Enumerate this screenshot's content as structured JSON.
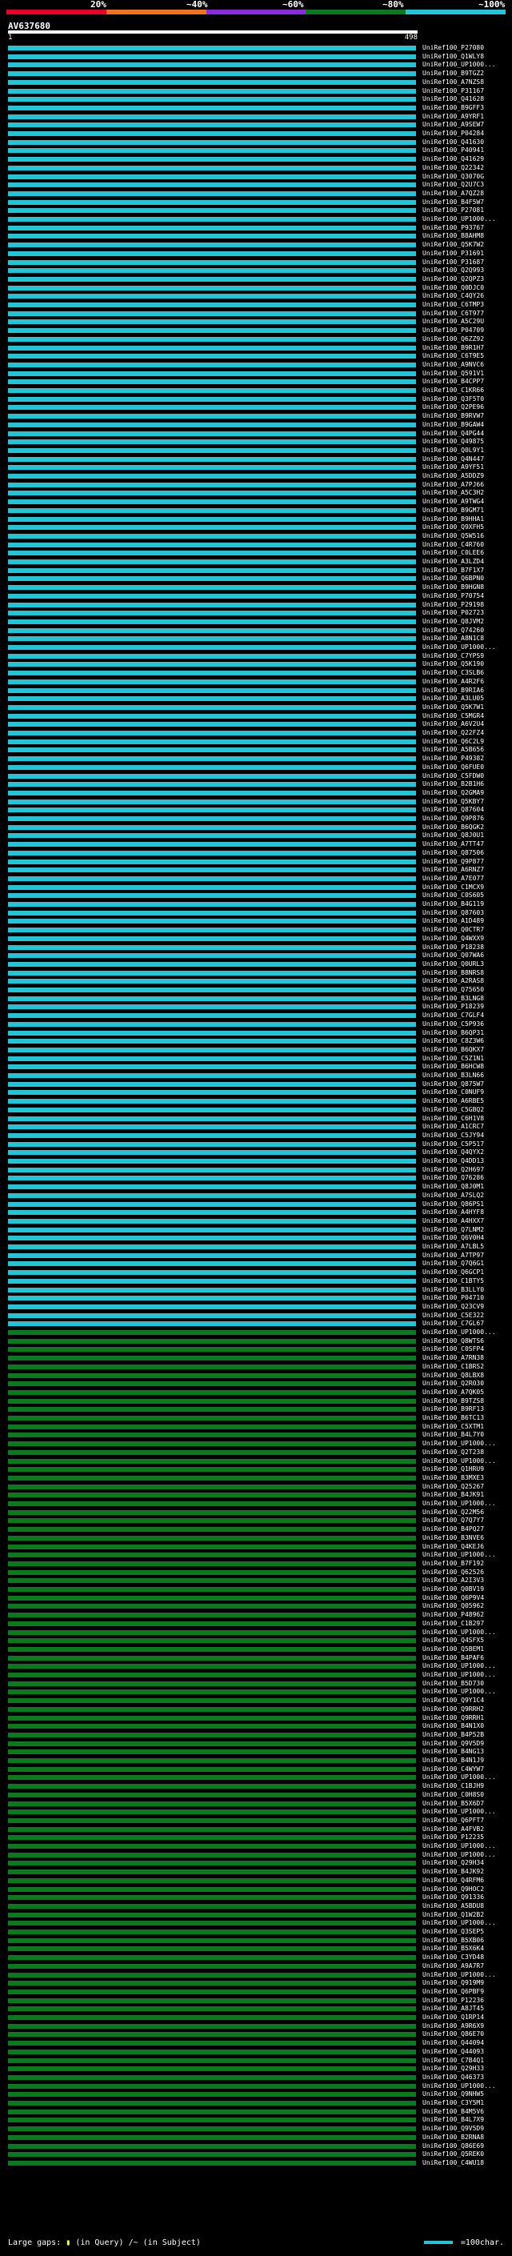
{
  "legend": {
    "labels": [
      "20%",
      "~40%",
      "~60%",
      "~80%",
      "~100%"
    ],
    "colors": [
      "#e8002a",
      "#f2711c",
      "#8a2be2",
      "#0b7a1e",
      "#22c5d6"
    ]
  },
  "query": {
    "title": "AV637680",
    "start_label": "1",
    "end_label": "498"
  },
  "hits": [
    {
      "label": "UniRef100_P27080",
      "color": "#22c5d6"
    },
    {
      "label": "UniRef100_Q1WLY8",
      "color": "#22c5d6"
    },
    {
      "label": "UniRef100_UP1000...",
      "color": "#22c5d6"
    },
    {
      "label": "UniRef100_B9TGZ2",
      "color": "#22c5d6"
    },
    {
      "label": "UniRef100_A7NZS8",
      "color": "#22c5d6"
    },
    {
      "label": "UniRef100_P31167",
      "color": "#22c5d6"
    },
    {
      "label": "UniRef100_Q41628",
      "color": "#22c5d6"
    },
    {
      "label": "UniRef100_B9GFF3",
      "color": "#22c5d6"
    },
    {
      "label": "UniRef100_A9YRF1",
      "color": "#22c5d6"
    },
    {
      "label": "UniRef100_A9SEW7",
      "color": "#22c5d6"
    },
    {
      "label": "UniRef100_P04284",
      "color": "#22c5d6"
    },
    {
      "label": "UniRef100_Q41630",
      "color": "#22c5d6"
    },
    {
      "label": "UniRef100_P40941",
      "color": "#22c5d6"
    },
    {
      "label": "UniRef100_Q41629",
      "color": "#22c5d6"
    },
    {
      "label": "UniRef100_Q22342",
      "color": "#22c5d6"
    },
    {
      "label": "UniRef100_Q3070G",
      "color": "#22c5d6"
    },
    {
      "label": "UniRef100_Q2U7C3",
      "color": "#22c5d6"
    },
    {
      "label": "UniRef100_A7QZ28",
      "color": "#22c5d6"
    },
    {
      "label": "UniRef100_B4F5W7",
      "color": "#22c5d6"
    },
    {
      "label": "UniRef100_P27081",
      "color": "#22c5d6"
    },
    {
      "label": "UniRef100_UP1000...",
      "color": "#22c5d6"
    },
    {
      "label": "UniRef100_P93767",
      "color": "#22c5d6"
    },
    {
      "label": "UniRef100_B8AHM8",
      "color": "#22c5d6"
    },
    {
      "label": "UniRef100_Q5K7W2",
      "color": "#22c5d6"
    },
    {
      "label": "UniRef100_P31691",
      "color": "#22c5d6"
    },
    {
      "label": "UniRef100_P31687",
      "color": "#22c5d6"
    },
    {
      "label": "UniRef100_Q2Q993",
      "color": "#22c5d6"
    },
    {
      "label": "UniRef100_Q2QPZ3",
      "color": "#22c5d6"
    },
    {
      "label": "UniRef100_Q0DJC0",
      "color": "#22c5d6"
    },
    {
      "label": "UniRef100_C4QY26",
      "color": "#22c5d6"
    },
    {
      "label": "UniRef100_C6TMP3",
      "color": "#22c5d6"
    },
    {
      "label": "UniRef100_C6T977",
      "color": "#22c5d6"
    },
    {
      "label": "UniRef100_A5C29U",
      "color": "#22c5d6"
    },
    {
      "label": "UniRef100_P04709",
      "color": "#22c5d6"
    },
    {
      "label": "UniRef100_Q6ZZ92",
      "color": "#22c5d6"
    },
    {
      "label": "UniRef100_B9R1H7",
      "color": "#22c5d6"
    },
    {
      "label": "UniRef100_C6T9E5",
      "color": "#22c5d6"
    },
    {
      "label": "UniRef100_A9NVC6",
      "color": "#22c5d6"
    },
    {
      "label": "UniRef100_Q591V1",
      "color": "#22c5d6"
    },
    {
      "label": "UniRef100_B4CPP7",
      "color": "#22c5d6"
    },
    {
      "label": "UniRef100_C1KR66",
      "color": "#22c5d6"
    },
    {
      "label": "UniRef100_Q3F5T0",
      "color": "#22c5d6"
    },
    {
      "label": "UniRef100_Q2PE96",
      "color": "#22c5d6"
    },
    {
      "label": "UniRef100_B9RVW7",
      "color": "#22c5d6"
    },
    {
      "label": "UniRef100_B9GAW4",
      "color": "#22c5d6"
    },
    {
      "label": "UniRef100_Q4PG44",
      "color": "#22c5d6"
    },
    {
      "label": "UniRef100_Q49875",
      "color": "#22c5d6"
    },
    {
      "label": "UniRef100_Q0L9Y1",
      "color": "#22c5d6"
    },
    {
      "label": "UniRef100_Q4N447",
      "color": "#22c5d6"
    },
    {
      "label": "UniRef100_A9YF51",
      "color": "#22c5d6"
    },
    {
      "label": "UniRef100_A5DDZ9",
      "color": "#22c5d6"
    },
    {
      "label": "UniRef100_A7PJ66",
      "color": "#22c5d6"
    },
    {
      "label": "UniRef100_A5C3H2",
      "color": "#22c5d6"
    },
    {
      "label": "UniRef100_A9TWG4",
      "color": "#22c5d6"
    },
    {
      "label": "UniRef100_B9GM71",
      "color": "#22c5d6"
    },
    {
      "label": "UniRef100_B9HHA1",
      "color": "#22c5d6"
    },
    {
      "label": "UniRef100_Q9XFH5",
      "color": "#22c5d6"
    },
    {
      "label": "UniRef100_Q5W516",
      "color": "#22c5d6"
    },
    {
      "label": "UniRef100_C4R760",
      "color": "#22c5d6"
    },
    {
      "label": "UniRef100_C0LEE6",
      "color": "#22c5d6"
    },
    {
      "label": "UniRef100_A3LZD4",
      "color": "#22c5d6"
    },
    {
      "label": "UniRef100_B7F1X7",
      "color": "#22c5d6"
    },
    {
      "label": "UniRef100_Q6BPN0",
      "color": "#22c5d6"
    },
    {
      "label": "UniRef100_B9HGN8",
      "color": "#22c5d6"
    },
    {
      "label": "UniRef100_P70754",
      "color": "#22c5d6"
    },
    {
      "label": "UniRef100_P29198",
      "color": "#22c5d6"
    },
    {
      "label": "UniRef100_P02723",
      "color": "#22c5d6"
    },
    {
      "label": "UniRef100_Q8JVM2",
      "color": "#22c5d6"
    },
    {
      "label": "UniRef100_Q74260",
      "color": "#22c5d6"
    },
    {
      "label": "UniRef100_A8N1C8",
      "color": "#22c5d6"
    },
    {
      "label": "UniRef100_UP1000...",
      "color": "#22c5d6"
    },
    {
      "label": "UniRef100_C7YPS9",
      "color": "#22c5d6"
    },
    {
      "label": "UniRef100_Q5K190",
      "color": "#22c5d6"
    },
    {
      "label": "UniRef100_C3SLB6",
      "color": "#22c5d6"
    },
    {
      "label": "UniRef100_A4R2F6",
      "color": "#22c5d6"
    },
    {
      "label": "UniRef100_B9RIA6",
      "color": "#22c5d6"
    },
    {
      "label": "UniRef100_A3LU05",
      "color": "#22c5d6"
    },
    {
      "label": "UniRef100_Q5K7W1",
      "color": "#22c5d6"
    },
    {
      "label": "UniRef100_C5MGR4",
      "color": "#22c5d6"
    },
    {
      "label": "UniRef100_A6V2U4",
      "color": "#22c5d6"
    },
    {
      "label": "UniRef100_Q22FZ4",
      "color": "#22c5d6"
    },
    {
      "label": "UniRef100_Q6C2L9",
      "color": "#22c5d6"
    },
    {
      "label": "UniRef100_A5B656",
      "color": "#22c5d6"
    },
    {
      "label": "UniRef100_P49382",
      "color": "#22c5d6"
    },
    {
      "label": "UniRef100_Q6FUE0",
      "color": "#22c5d6"
    },
    {
      "label": "UniRef100_C5FDW0",
      "color": "#22c5d6"
    },
    {
      "label": "UniRef100_B2B1H6",
      "color": "#22c5d6"
    },
    {
      "label": "UniRef100_Q2GMA9",
      "color": "#22c5d6"
    },
    {
      "label": "UniRef100_Q5KBY7",
      "color": "#22c5d6"
    },
    {
      "label": "UniRef100_Q87604",
      "color": "#22c5d6"
    },
    {
      "label": "UniRef100_Q9P876",
      "color": "#22c5d6"
    },
    {
      "label": "UniRef100_B6QGK2",
      "color": "#22c5d6"
    },
    {
      "label": "UniRef100_Q8J0U1",
      "color": "#22c5d6"
    },
    {
      "label": "UniRef100_A7TT47",
      "color": "#22c5d6"
    },
    {
      "label": "UniRef100_Q87506",
      "color": "#22c5d6"
    },
    {
      "label": "UniRef100_Q9P877",
      "color": "#22c5d6"
    },
    {
      "label": "UniRef100_A6RNZ7",
      "color": "#22c5d6"
    },
    {
      "label": "UniRef100_A7E077",
      "color": "#22c5d6"
    },
    {
      "label": "UniRef100_C1MCX9",
      "color": "#22c5d6"
    },
    {
      "label": "UniRef100_C0S605",
      "color": "#22c5d6"
    },
    {
      "label": "UniRef100_B4G119",
      "color": "#22c5d6"
    },
    {
      "label": "UniRef100_Q87603",
      "color": "#22c5d6"
    },
    {
      "label": "UniRef100_A1D489",
      "color": "#22c5d6"
    },
    {
      "label": "UniRef100_Q0CTR7",
      "color": "#22c5d6"
    },
    {
      "label": "UniRef100_Q4WXX9",
      "color": "#22c5d6"
    },
    {
      "label": "UniRef100_P18238",
      "color": "#22c5d6"
    },
    {
      "label": "UniRef100_Q07WA6",
      "color": "#22c5d6"
    },
    {
      "label": "UniRef100_Q0URL3",
      "color": "#22c5d6"
    },
    {
      "label": "UniRef100_B8NRS8",
      "color": "#22c5d6"
    },
    {
      "label": "UniRef100_A2RAS8",
      "color": "#22c5d6"
    },
    {
      "label": "UniRef100_Q75650",
      "color": "#22c5d6"
    },
    {
      "label": "UniRef100_B3LNG8",
      "color": "#22c5d6"
    },
    {
      "label": "UniRef100_P18239",
      "color": "#22c5d6"
    },
    {
      "label": "UniRef100_C7GLF4",
      "color": "#22c5d6"
    },
    {
      "label": "UniRef100_C5P936",
      "color": "#22c5d6"
    },
    {
      "label": "UniRef100_B6QP31",
      "color": "#22c5d6"
    },
    {
      "label": "UniRef100_C8Z3W6",
      "color": "#22c5d6"
    },
    {
      "label": "UniRef100_B6QKX7",
      "color": "#22c5d6"
    },
    {
      "label": "UniRef100_C5Z1N1",
      "color": "#22c5d6"
    },
    {
      "label": "UniRef100_B6HCW8",
      "color": "#22c5d6"
    },
    {
      "label": "UniRef100_B3LN66",
      "color": "#22c5d6"
    },
    {
      "label": "UniRef100_Q875W7",
      "color": "#22c5d6"
    },
    {
      "label": "UniRef100_C0NUF9",
      "color": "#22c5d6"
    },
    {
      "label": "UniRef100_A6RBE5",
      "color": "#22c5d6"
    },
    {
      "label": "UniRef100_C5GBQ2",
      "color": "#22c5d6"
    },
    {
      "label": "UniRef100_C6H1V8",
      "color": "#22c5d6"
    },
    {
      "label": "UniRef100_A1CRC7",
      "color": "#22c5d6"
    },
    {
      "label": "UniRef100_C5JY94",
      "color": "#22c5d6"
    },
    {
      "label": "UniRef100_C5P517",
      "color": "#22c5d6"
    },
    {
      "label": "UniRef100_Q4QYX2",
      "color": "#22c5d6"
    },
    {
      "label": "UniRef100_Q4DD13",
      "color": "#22c5d6"
    },
    {
      "label": "UniRef100_Q2H697",
      "color": "#22c5d6"
    },
    {
      "label": "UniRef100_Q76286",
      "color": "#22c5d6"
    },
    {
      "label": "UniRef100_Q8J0M1",
      "color": "#22c5d6"
    },
    {
      "label": "UniRef100_A7SLQ2",
      "color": "#22c5d6"
    },
    {
      "label": "UniRef100_Q86PS1",
      "color": "#22c5d6"
    },
    {
      "label": "UniRef100_A4HYF8",
      "color": "#22c5d6"
    },
    {
      "label": "UniRef100_A4HXX7",
      "color": "#22c5d6"
    },
    {
      "label": "UniRef100_Q7LNM2",
      "color": "#22c5d6"
    },
    {
      "label": "UniRef100_Q6V0H4",
      "color": "#22c5d6"
    },
    {
      "label": "UniRef100_A7LBL5",
      "color": "#22c5d6"
    },
    {
      "label": "UniRef100_A7TP97",
      "color": "#22c5d6"
    },
    {
      "label": "UniRef100_Q7Q6G1",
      "color": "#22c5d6"
    },
    {
      "label": "UniRef100_Q6GCP1",
      "color": "#22c5d6"
    },
    {
      "label": "UniRef100_C1BTY5",
      "color": "#22c5d6"
    },
    {
      "label": "UniRef100_B3LLY0",
      "color": "#22c5d6"
    },
    {
      "label": "UniRef100_P04710",
      "color": "#22c5d6"
    },
    {
      "label": "UniRef100_Q23CV9",
      "color": "#22c5d6"
    },
    {
      "label": "UniRef100_C5E322",
      "color": "#22c5d6"
    },
    {
      "label": "UniRef100_C7GL67",
      "color": "#22c5d6"
    },
    {
      "label": "UniRef100_UP1000...",
      "color": "#0b7a1e"
    },
    {
      "label": "UniRef100_Q8WTS6",
      "color": "#0b7a1e"
    },
    {
      "label": "UniRef100_C0SFP4",
      "color": "#0b7a1e"
    },
    {
      "label": "UniRef100_A7RN38",
      "color": "#0b7a1e"
    },
    {
      "label": "UniRef100_C1BRS2",
      "color": "#0b7a1e"
    },
    {
      "label": "UniRef100_Q8LBX8",
      "color": "#0b7a1e"
    },
    {
      "label": "UniRef100_Q2R030",
      "color": "#0b7a1e"
    },
    {
      "label": "UniRef100_A7QK05",
      "color": "#0b7a1e"
    },
    {
      "label": "UniRef100_B9TZS8",
      "color": "#0b7a1e"
    },
    {
      "label": "UniRef100_B9RF13",
      "color": "#0b7a1e"
    },
    {
      "label": "UniRef100_B6TC13",
      "color": "#0b7a1e"
    },
    {
      "label": "UniRef100_C5XTM1",
      "color": "#0b7a1e"
    },
    {
      "label": "UniRef100_B4L7Y0",
      "color": "#0b7a1e"
    },
    {
      "label": "UniRef100_UP1000...",
      "color": "#0b7a1e"
    },
    {
      "label": "UniRef100_Q2T238",
      "color": "#0b7a1e"
    },
    {
      "label": "UniRef100_UP1000...",
      "color": "#0b7a1e"
    },
    {
      "label": "UniRef100_Q1HRU9",
      "color": "#0b7a1e"
    },
    {
      "label": "UniRef100_B3MXE3",
      "color": "#0b7a1e"
    },
    {
      "label": "UniRef100_Q25267",
      "color": "#0b7a1e"
    },
    {
      "label": "UniRef100_B4JK91",
      "color": "#0b7a1e"
    },
    {
      "label": "UniRef100_UP1000...",
      "color": "#0b7a1e"
    },
    {
      "label": "UniRef100_Q22M56",
      "color": "#0b7a1e"
    },
    {
      "label": "UniRef100_Q7Q7Y7",
      "color": "#0b7a1e"
    },
    {
      "label": "UniRef100_B4PQ27",
      "color": "#0b7a1e"
    },
    {
      "label": "UniRef100_B3NVE6",
      "color": "#0b7a1e"
    },
    {
      "label": "UniRef100_Q4KEJ6",
      "color": "#0b7a1e"
    },
    {
      "label": "UniRef100_UP1000...",
      "color": "#0b7a1e"
    },
    {
      "label": "UniRef100_B7F192",
      "color": "#0b7a1e"
    },
    {
      "label": "UniRef100_Q62526",
      "color": "#0b7a1e"
    },
    {
      "label": "UniRef100_A2I3V3",
      "color": "#0b7a1e"
    },
    {
      "label": "UniRef100_Q0BV19",
      "color": "#0b7a1e"
    },
    {
      "label": "UniRef100_Q6P9V4",
      "color": "#0b7a1e"
    },
    {
      "label": "UniRef100_Q05962",
      "color": "#0b7a1e"
    },
    {
      "label": "UniRef100_P48962",
      "color": "#0b7a1e"
    },
    {
      "label": "UniRef100_C1B297",
      "color": "#0b7a1e"
    },
    {
      "label": "UniRef100_UP1000...",
      "color": "#0b7a1e"
    },
    {
      "label": "UniRef100_Q4SFX5",
      "color": "#0b7a1e"
    },
    {
      "label": "UniRef100_Q5BEM1",
      "color": "#0b7a1e"
    },
    {
      "label": "UniRef100_B4PAF6",
      "color": "#0b7a1e"
    },
    {
      "label": "UniRef100_UP1000...",
      "color": "#0b7a1e"
    },
    {
      "label": "UniRef100_UP1000...",
      "color": "#0b7a1e"
    },
    {
      "label": "UniRef100_B5D730",
      "color": "#0b7a1e"
    },
    {
      "label": "UniRef100_UP1000...",
      "color": "#0b7a1e"
    },
    {
      "label": "UniRef100_Q9Y1C4",
      "color": "#0b7a1e"
    },
    {
      "label": "UniRef100_Q9RRH2",
      "color": "#0b7a1e"
    },
    {
      "label": "UniRef100_Q9RRH1",
      "color": "#0b7a1e"
    },
    {
      "label": "UniRef100_B4N1X0",
      "color": "#0b7a1e"
    },
    {
      "label": "UniRef100_B4P52B",
      "color": "#0b7a1e"
    },
    {
      "label": "UniRef100_Q9V5D9",
      "color": "#0b7a1e"
    },
    {
      "label": "UniRef100_B4NG13",
      "color": "#0b7a1e"
    },
    {
      "label": "UniRef100_B4N1J9",
      "color": "#0b7a1e"
    },
    {
      "label": "UniRef100_C4WYW7",
      "color": "#0b7a1e"
    },
    {
      "label": "UniRef100_UP1000...",
      "color": "#0b7a1e"
    },
    {
      "label": "UniRef100_C1BJH9",
      "color": "#0b7a1e"
    },
    {
      "label": "UniRef100_C0H8S0",
      "color": "#0b7a1e"
    },
    {
      "label": "UniRef100_B5X6D7",
      "color": "#0b7a1e"
    },
    {
      "label": "UniRef100_UP1000...",
      "color": "#0b7a1e"
    },
    {
      "label": "UniRef100_Q6PFT7",
      "color": "#0b7a1e"
    },
    {
      "label": "UniRef100_A4FVB2",
      "color": "#0b7a1e"
    },
    {
      "label": "UniRef100_P12235",
      "color": "#0b7a1e"
    },
    {
      "label": "UniRef100_UP1000...",
      "color": "#0b7a1e"
    },
    {
      "label": "UniRef100_UP1000...",
      "color": "#0b7a1e"
    },
    {
      "label": "UniRef100_Q29H34",
      "color": "#0b7a1e"
    },
    {
      "label": "UniRef100_B4JK92",
      "color": "#0b7a1e"
    },
    {
      "label": "UniRef100_Q4RFM6",
      "color": "#0b7a1e"
    },
    {
      "label": "UniRef100_Q9HOC2",
      "color": "#0b7a1e"
    },
    {
      "label": "UniRef100_Q91336",
      "color": "#0b7a1e"
    },
    {
      "label": "UniRef100_A5BDU8",
      "color": "#0b7a1e"
    },
    {
      "label": "UniRef100_Q1W2B2",
      "color": "#0b7a1e"
    },
    {
      "label": "UniRef100_UP1000...",
      "color": "#0b7a1e"
    },
    {
      "label": "UniRef100_Q3SEP5",
      "color": "#0b7a1e"
    },
    {
      "label": "UniRef100_B5XB06",
      "color": "#0b7a1e"
    },
    {
      "label": "UniRef100_B5X6K4",
      "color": "#0b7a1e"
    },
    {
      "label": "UniRef100_C3YD48",
      "color": "#0b7a1e"
    },
    {
      "label": "UniRef100_A9A7R7",
      "color": "#0b7a1e"
    },
    {
      "label": "UniRef100_UP1000...",
      "color": "#0b7a1e"
    },
    {
      "label": "UniRef100_Q919M9",
      "color": "#0b7a1e"
    },
    {
      "label": "UniRef100_Q6PBF9",
      "color": "#0b7a1e"
    },
    {
      "label": "UniRef100_P12236",
      "color": "#0b7a1e"
    },
    {
      "label": "UniRef100_A8JT45",
      "color": "#0b7a1e"
    },
    {
      "label": "UniRef100_Q1RP14",
      "color": "#0b7a1e"
    },
    {
      "label": "UniRef100_A9R6X9",
      "color": "#0b7a1e"
    },
    {
      "label": "UniRef100_Q86E70",
      "color": "#0b7a1e"
    },
    {
      "label": "UniRef100_Q44094",
      "color": "#0b7a1e"
    },
    {
      "label": "UniRef100_Q44093",
      "color": "#0b7a1e"
    },
    {
      "label": "UniRef100_C7B4Q1",
      "color": "#0b7a1e"
    },
    {
      "label": "UniRef100_Q29H33",
      "color": "#0b7a1e"
    },
    {
      "label": "UniRef100_Q46373",
      "color": "#0b7a1e"
    },
    {
      "label": "UniRef100_UP1000...",
      "color": "#0b7a1e"
    },
    {
      "label": "UniRef100_Q9NHW5",
      "color": "#0b7a1e"
    },
    {
      "label": "UniRef100_C3Y5M1",
      "color": "#0b7a1e"
    },
    {
      "label": "UniRef100_B4M5V6",
      "color": "#0b7a1e"
    },
    {
      "label": "UniRef100_B4L7X9",
      "color": "#0b7a1e"
    },
    {
      "label": "UniRef100_Q9V5D9",
      "color": "#0b7a1e"
    },
    {
      "label": "UniRef100_B2RNA8",
      "color": "#0b7a1e"
    },
    {
      "label": "UniRef100_Q86E69",
      "color": "#0b7a1e"
    },
    {
      "label": "UniRef100_Q5REK0",
      "color": "#0b7a1e"
    },
    {
      "label": "UniRef100_C4WU18",
      "color": "#0b7a1e"
    }
  ],
  "footer": {
    "large_gaps_label": "Large gaps:",
    "query_gap_label": "(in Query)",
    "subject_gap_label": "(in Subject)",
    "scale_label": "=100char."
  }
}
